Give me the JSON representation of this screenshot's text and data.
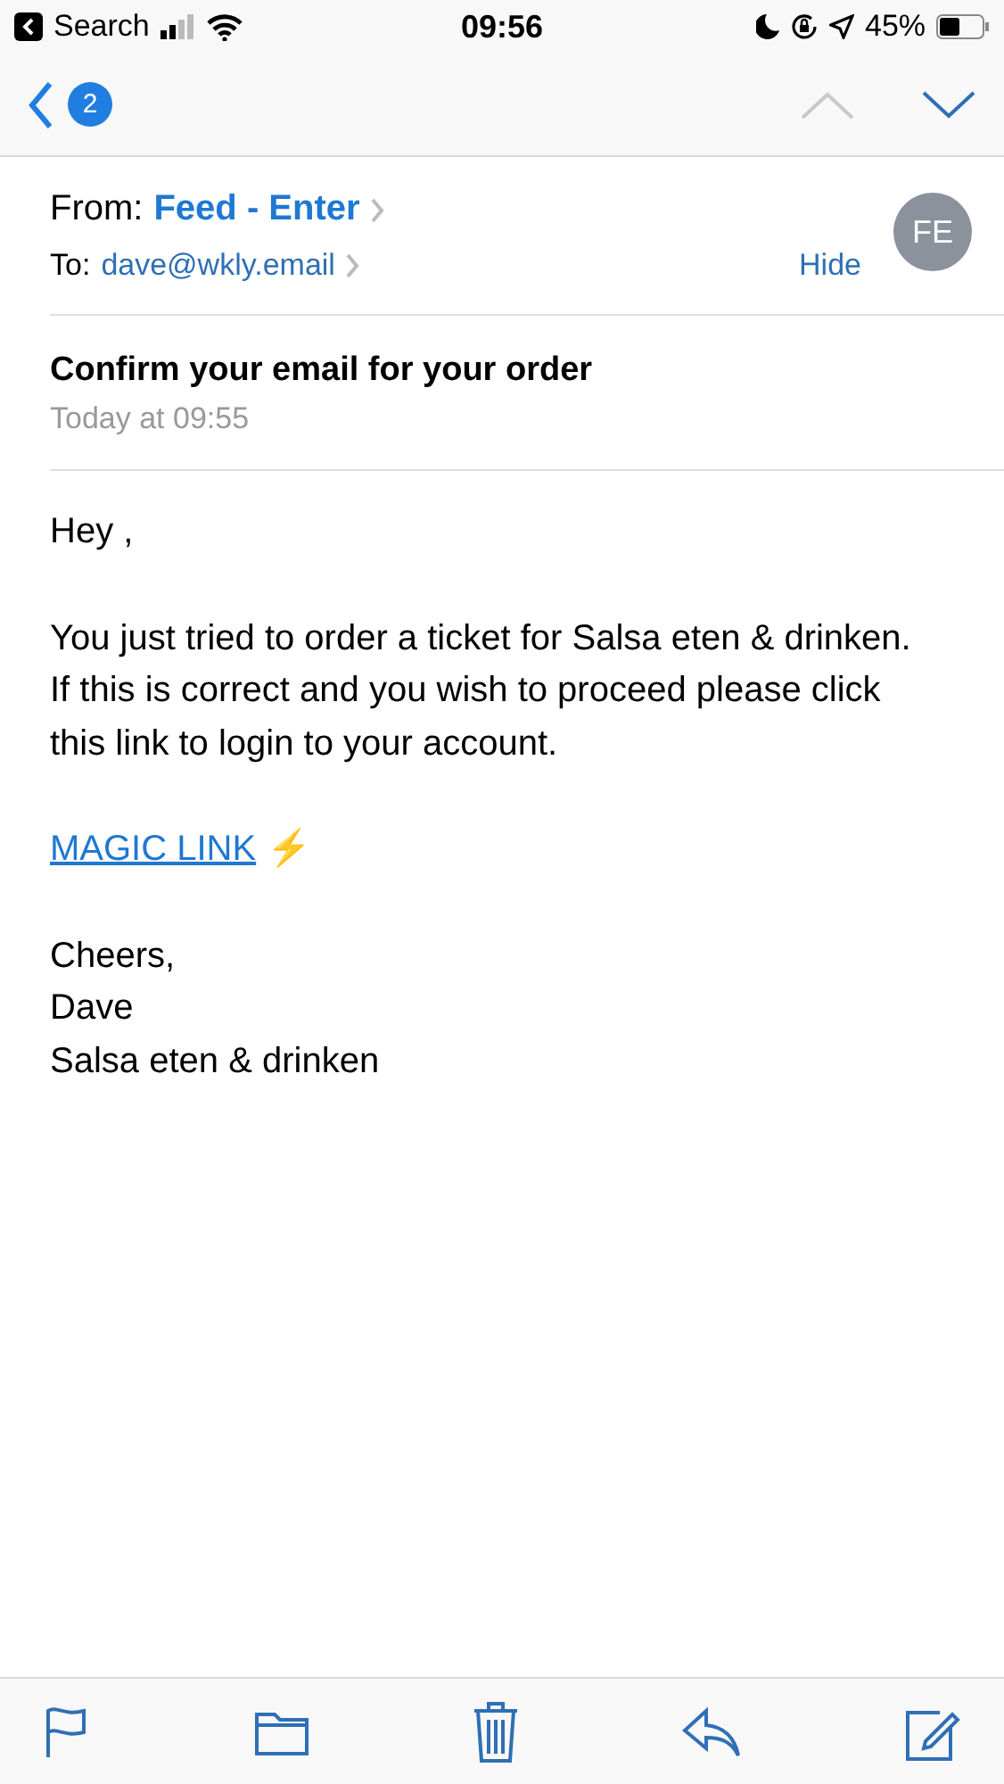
{
  "status_bar": {
    "back_label": "Search",
    "time": "09:56",
    "battery": "45%"
  },
  "nav_bar": {
    "unread_count": "2",
    "previous_disabled": true,
    "next_disabled": false
  },
  "header": {
    "from_label": "From:",
    "from": "Feed - Enter",
    "to_label": "To:",
    "to": "dave@wkly.email",
    "hide": "Hide",
    "avatar": "FE"
  },
  "message": {
    "subject": "Confirm your email for your order",
    "date": "Today at 09:55"
  },
  "body": {
    "greeting": "Hey ,",
    "paragraph": "You just tried to order a ticket for Salsa eten & drinken.\nIf this is correct and you wish to proceed please click\nthis link to login to your account.",
    "link": "MAGIC LINK",
    "link_emoji": "⚡",
    "signoff": "Cheers,\nDave\nSalsa eten & drinken"
  },
  "toolbar": [
    {
      "kind": "flag"
    },
    {
      "kind": "folder"
    },
    {
      "kind": "trash"
    },
    {
      "kind": "reply"
    },
    {
      "kind": "compose"
    }
  ]
}
